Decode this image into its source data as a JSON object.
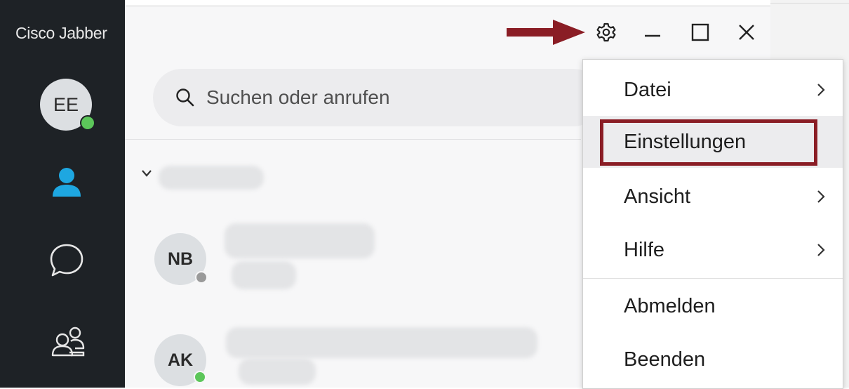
{
  "app": {
    "title": "Cisco Jabber"
  },
  "user": {
    "initials": "EE",
    "presence": "available"
  },
  "sidebar": {
    "items": [
      {
        "name": "contacts",
        "icon": "person-icon",
        "active": true
      },
      {
        "name": "chats",
        "icon": "chat-bubble-icon",
        "active": false
      },
      {
        "name": "meetings",
        "icon": "group-icon",
        "active": false
      }
    ]
  },
  "search": {
    "placeholder": "Suchen oder anrufen"
  },
  "contacts": [
    {
      "initials": "NB",
      "presence": "offline"
    },
    {
      "initials": "AK",
      "presence": "available"
    }
  ],
  "menu": {
    "items": [
      {
        "label": "Datei",
        "submenu": true
      },
      {
        "label": "Einstellungen",
        "submenu": false,
        "highlighted": true
      },
      {
        "label": "Ansicht",
        "submenu": true
      },
      {
        "label": "Hilfe",
        "submenu": true
      },
      {
        "label": "Abmelden",
        "submenu": false
      },
      {
        "label": "Beenden",
        "submenu": false
      }
    ]
  },
  "colors": {
    "sidebar_bg": "#1e2226",
    "accent": "#1ea7e1",
    "annotation": "#8a1d25",
    "presence_available": "#5cc65a",
    "presence_offline": "#9a9a9a"
  }
}
